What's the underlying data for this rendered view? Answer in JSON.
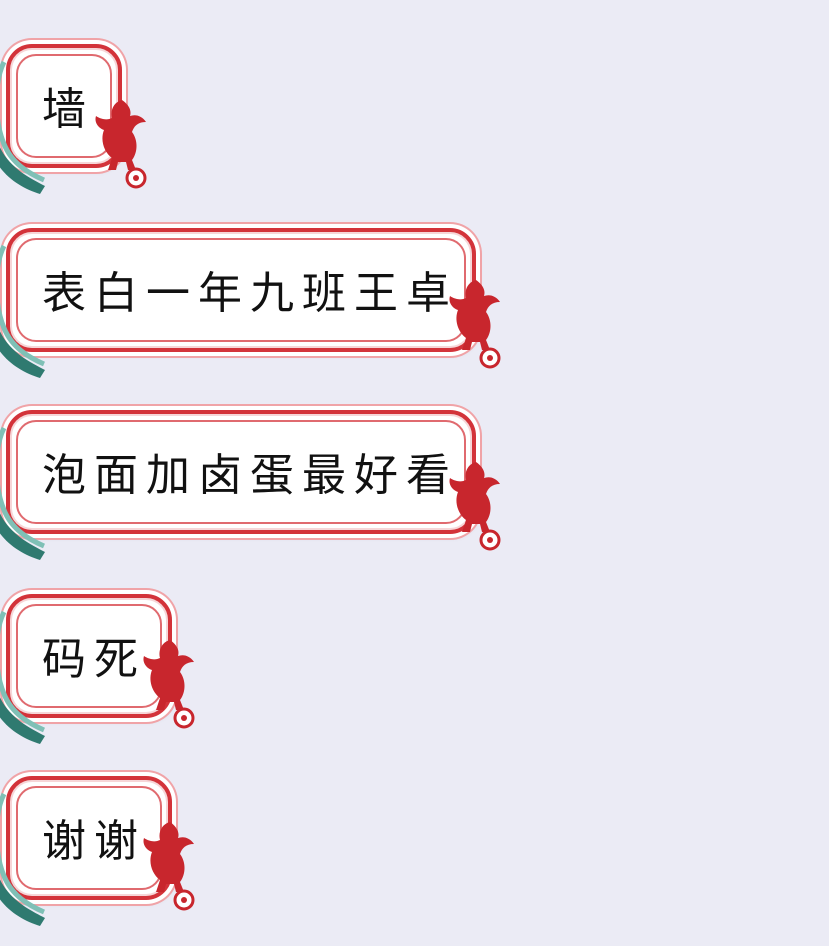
{
  "messages": [
    {
      "text": "墙"
    },
    {
      "text": "表白一年九班王卓"
    },
    {
      "text": "泡面加卤蛋最好看"
    },
    {
      "text": "码死"
    },
    {
      "text": "谢谢"
    }
  ],
  "colors": {
    "background": "#ebebf5",
    "bubble_border": "#d3333a",
    "ribbon": "#3f8f84",
    "text": "#111111"
  },
  "icons": {
    "corner_decoration": "liverbird-icon",
    "side_decoration": "ribbon-icon"
  }
}
